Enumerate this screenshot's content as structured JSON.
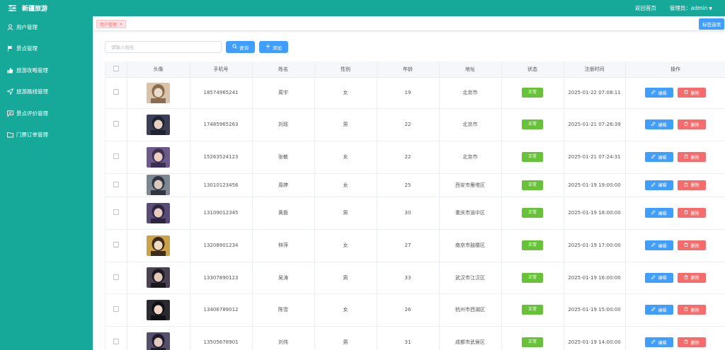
{
  "header": {
    "title": "新疆旅游",
    "home_link": "返回首页",
    "admin_label": "管理员：admin"
  },
  "sidebar": {
    "items": [
      {
        "label": "用户管理",
        "icon": "user-icon"
      },
      {
        "label": "景点管理",
        "icon": "flag-icon"
      },
      {
        "label": "旅游攻略管理",
        "icon": "thumb-icon"
      },
      {
        "label": "旅游路线管理",
        "icon": "send-icon"
      },
      {
        "label": "景点评价管理",
        "icon": "message-icon"
      },
      {
        "label": "门票订单管理",
        "icon": "folder-icon"
      }
    ]
  },
  "tags": {
    "active_tag": "用户管理",
    "close_tags_label": "标签选项"
  },
  "toolbar": {
    "search_placeholder": "请输入姓名",
    "search_value": "",
    "query_label": "查询",
    "add_label": "添加"
  },
  "table": {
    "columns": [
      "头像",
      "手机号",
      "姓名",
      "性别",
      "年龄",
      "地址",
      "状态",
      "注册时间",
      "操作"
    ],
    "edit_label": "编辑",
    "delete_label": "删除",
    "rows": [
      {
        "phone": "18574965241",
        "name": "周宇",
        "gender": "女",
        "age": "19",
        "address": "北京市",
        "status": "正常",
        "time": "2025-01-22 07:08:11"
      },
      {
        "phone": "17485965263",
        "name": "刘瑶",
        "gender": "男",
        "age": "22",
        "address": "北京市",
        "status": "正常",
        "time": "2025-01-21 07:26:39"
      },
      {
        "phone": "15263524123",
        "name": "张敏",
        "gender": "女",
        "age": "22",
        "address": "北京市",
        "status": "正常",
        "time": "2025-01-21 07:24:31"
      },
      {
        "phone": "13010123456",
        "name": "周婷",
        "gender": "女",
        "age": "25",
        "address": "西安市雁塔区",
        "status": "正常",
        "time": "2025-01-19 19:00:00"
      },
      {
        "phone": "13109012345",
        "name": "黄磊",
        "gender": "男",
        "age": "30",
        "address": "重庆市渝中区",
        "status": "正常",
        "time": "2025-01-19 18:00:00"
      },
      {
        "phone": "13208901234",
        "name": "林萍",
        "gender": "女",
        "age": "27",
        "address": "南京市鼓楼区",
        "status": "正常",
        "time": "2025-01-19 17:00:00"
      },
      {
        "phone": "13307890123",
        "name": "吴涛",
        "gender": "男",
        "age": "33",
        "address": "武汉市江汉区",
        "status": "正常",
        "time": "2025-01-19 16:00:00"
      },
      {
        "phone": "13406789012",
        "name": "陈雪",
        "gender": "女",
        "age": "26",
        "address": "杭州市西湖区",
        "status": "正常",
        "time": "2025-01-19 15:00:00"
      },
      {
        "phone": "13505678901",
        "name": "刘伟",
        "gender": "男",
        "age": "31",
        "address": "成都市武侯区",
        "status": "正常",
        "time": "2025-01-19 14:00:00"
      }
    ]
  },
  "colors": {
    "brand": "#16a99a",
    "primary": "#409eff",
    "success": "#67c23a",
    "danger": "#f56c6c"
  }
}
